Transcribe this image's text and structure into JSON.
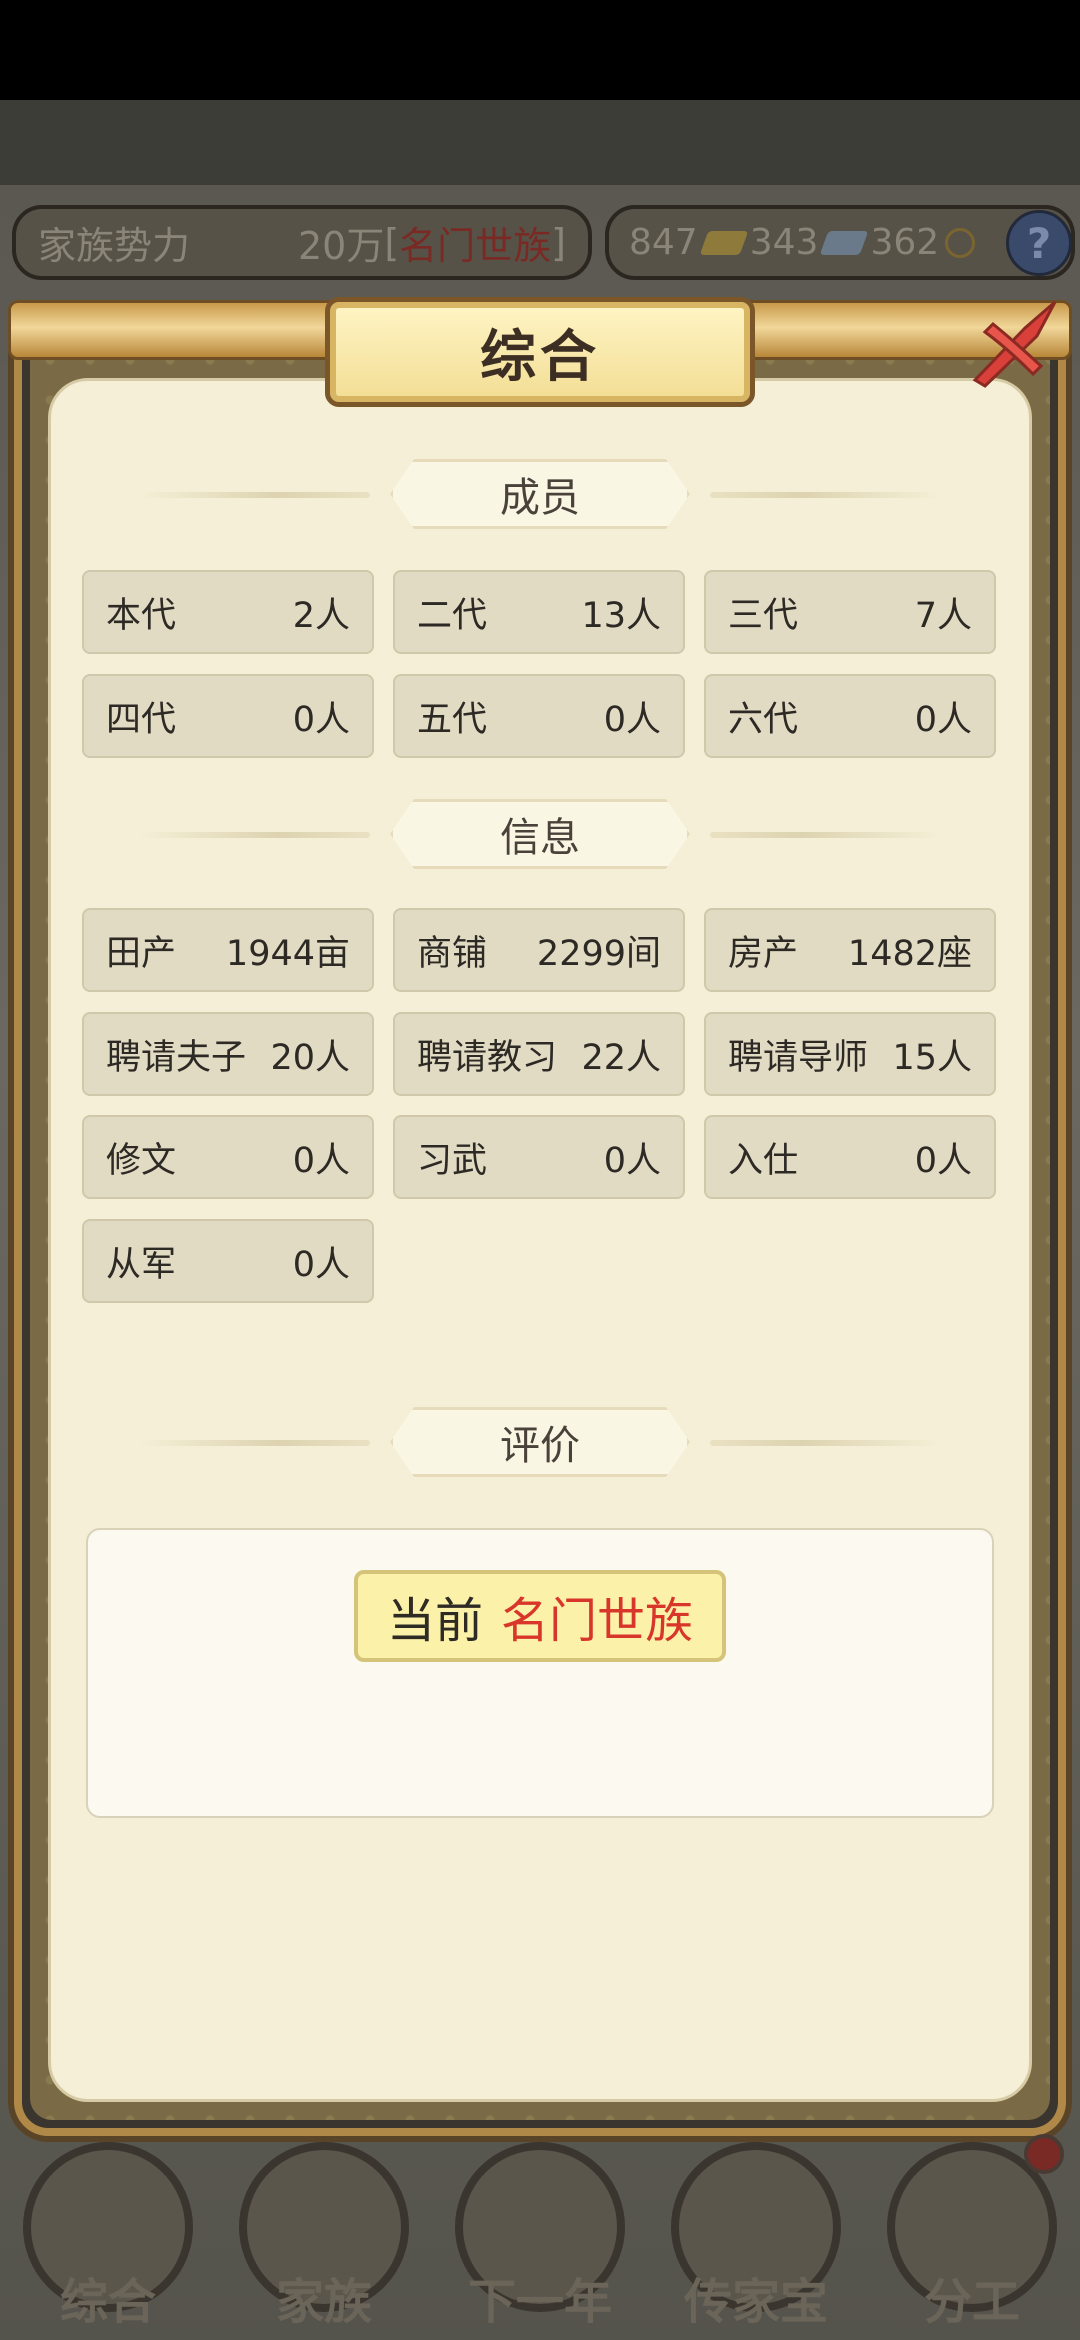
{
  "background": {
    "resources_left": {
      "label": "家族势力",
      "value": "20万",
      "rank": "名门世族"
    },
    "resources_right": {
      "gold": "847",
      "silver": "343",
      "coin": "362"
    }
  },
  "dialog": {
    "title": "综合",
    "members": {
      "heading": "成员",
      "items": [
        {
          "label": "本代",
          "value": "2人"
        },
        {
          "label": "二代",
          "value": "13人"
        },
        {
          "label": "三代",
          "value": "7人"
        },
        {
          "label": "四代",
          "value": "0人"
        },
        {
          "label": "五代",
          "value": "0人"
        },
        {
          "label": "六代",
          "value": "0人"
        }
      ]
    },
    "info": {
      "heading": "信息",
      "items": [
        {
          "label": "田产",
          "value": "1944亩"
        },
        {
          "label": "商铺",
          "value": "2299间"
        },
        {
          "label": "房产",
          "value": "1482座"
        },
        {
          "label": "聘请夫子",
          "value": "20人"
        },
        {
          "label": "聘请教习",
          "value": "22人"
        },
        {
          "label": "聘请导师",
          "value": "15人"
        },
        {
          "label": "修文",
          "value": "0人"
        },
        {
          "label": "习武",
          "value": "0人"
        },
        {
          "label": "入仕",
          "value": "0人"
        },
        {
          "label": "从军",
          "value": "0人"
        }
      ]
    },
    "evaluation": {
      "heading": "评价",
      "prefix": "当前",
      "rank": "名门世族"
    }
  },
  "bottom_nav": [
    {
      "label": "综合"
    },
    {
      "label": "家族"
    },
    {
      "label": "下一年"
    },
    {
      "label": "传家宝"
    },
    {
      "label": "分工"
    }
  ],
  "colors": {
    "panel_bg": "#f4efd6",
    "cell_bg": "#e2dbc3",
    "rank_red": "#d8362a",
    "badge_yellow": "#fbf1a8"
  }
}
